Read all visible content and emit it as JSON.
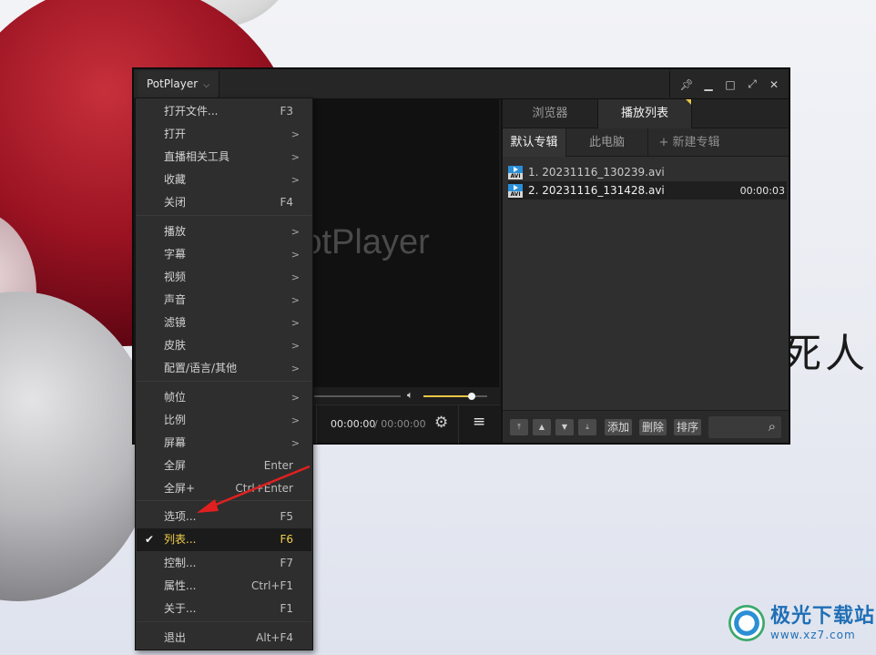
{
  "background": {
    "calligraphy": "死人",
    "watermark": {
      "site_name": "极光下载站",
      "url": "www.xz7.com"
    }
  },
  "player": {
    "app_menu_label": "PotPlayer",
    "window_controls": {
      "pin": "pin-icon",
      "minimize": "minimize-icon",
      "maximize": "maximize-icon",
      "fullscreen": "fullscreen-icon",
      "close": "close-icon"
    },
    "logo_text": "PotPlayer",
    "time_current": "00:00:00",
    "time_separator": "/ 00:00:00",
    "volume_level": 0.75
  },
  "panel": {
    "tabs": [
      "浏览器",
      "播放列表"
    ],
    "subtabs": [
      "默认专辑",
      "此电脑",
      "+ 新建专辑"
    ],
    "playlist": [
      {
        "name": "1. 20231116_130239.avi",
        "duration": ""
      },
      {
        "name": "2. 20231116_131428.avi",
        "duration": "00:00:03"
      }
    ],
    "bottom_buttons": [
      "添加",
      "删除",
      "排序"
    ],
    "file_icon_label": "AVI"
  },
  "menu": {
    "items": [
      {
        "label": "打开文件...",
        "key": "F3"
      },
      {
        "label": "打开",
        "key": ">"
      },
      {
        "label": "直播相关工具",
        "key": ">"
      },
      {
        "label": "收藏",
        "key": ">"
      },
      {
        "label": "关闭",
        "key": "F4"
      },
      {
        "label": "播放",
        "key": ">"
      },
      {
        "label": "字幕",
        "key": ">"
      },
      {
        "label": "视频",
        "key": ">"
      },
      {
        "label": "声音",
        "key": ">"
      },
      {
        "label": "滤镜",
        "key": ">"
      },
      {
        "label": "皮肤",
        "key": ">"
      },
      {
        "label": "配置/语言/其他",
        "key": ">"
      },
      {
        "label": "帧位",
        "key": ">"
      },
      {
        "label": "比例",
        "key": ">"
      },
      {
        "label": "屏幕",
        "key": ">"
      },
      {
        "label": "全屏",
        "key": "Enter"
      },
      {
        "label": "全屏+",
        "key": "Ctrl+Enter"
      },
      {
        "label": "选项...",
        "key": "F5"
      },
      {
        "label": "列表...",
        "key": "F6"
      },
      {
        "label": "控制...",
        "key": "F7"
      },
      {
        "label": "属性...",
        "key": "Ctrl+F1"
      },
      {
        "label": "关于...",
        "key": "F1"
      },
      {
        "label": "退出",
        "key": "Alt+F4"
      }
    ],
    "checked_item": "列表...",
    "accent_color": "#f2cf4a"
  },
  "annotation": {
    "arrow_color": "#e02020"
  }
}
